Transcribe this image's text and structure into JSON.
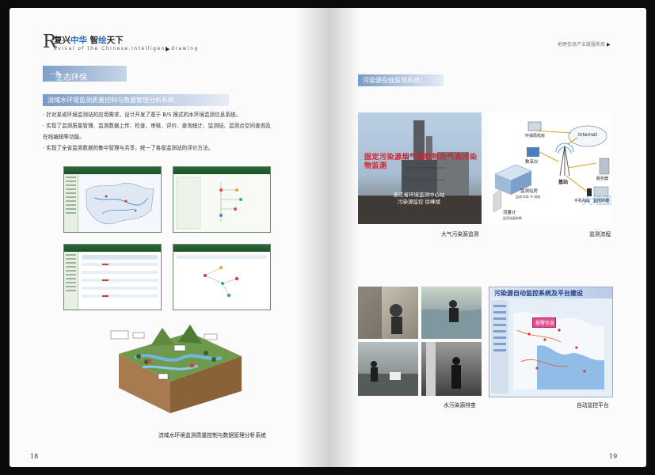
{
  "left_page": {
    "logo": {
      "R": "R",
      "line1_a": "复兴",
      "line1_b": "中华",
      "line1_c": "  智",
      "line1_d": "绘",
      "line1_e": "天下",
      "line2": "evival  of  the  Chinese.Intelligent  drawing",
      "arrow": "▶"
    },
    "section_title": "生态环保",
    "section_icon": "✎",
    "subheading": "流域水环境监测质量控制与数据管理分析系统：",
    "bullets": [
      "· 针对某省环境监测站的应用需求，设计开发了基于 B/S 模式的水环境监测信息系统。",
      "· 实现了监测质量管理、监测数据上传、检查、审核、评价、查询统计、监测站、监测点空间查询及",
      "  在线编辑等功能。",
      "· 实现了全省监测数据的集中管理与共享，统一了各级监测站的评价方法。"
    ],
    "caption": "流域水环境监测质量控制与数据管理分析系统",
    "page_number": "18"
  },
  "right_page": {
    "tagline": "地理信息产业链服务商",
    "tagline_arrow": "▶",
    "subheading": "污染源在线监测系统：",
    "photo1_overlay_red": "固定污染源烟气颗粒物及气态污染物监测",
    "photo1_overlay_white": "浙江省环境监测中心站 污染源监控 徐峰斌",
    "diagram_labels": {
      "internet": "Internet",
      "env_bureau": "环保局机房",
      "collector": "数采仪",
      "base_station": "基站",
      "server": "服务器",
      "monitor_room": "监测站房",
      "flowmeter": "流量计",
      "phone": "手机App",
      "terminal": "监控终端",
      "params": "监测流量参数",
      "link": "监测 DID 节 网络"
    },
    "caption_air": "大气污染源监测",
    "caption_flow": "监测流程",
    "caption_water": "水污染源排查",
    "platform_title": "污染源自动监控系统及平台建设",
    "platform_badge": "报警信息",
    "caption_platform": "自动监控平台",
    "page_number": "19"
  }
}
